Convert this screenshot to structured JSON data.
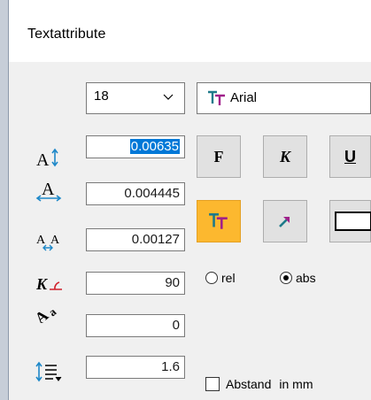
{
  "window": {
    "title": "Textattribute"
  },
  "size_combo": {
    "value": "18"
  },
  "font_combo": {
    "value": "Arial"
  },
  "fields": [
    {
      "icon": "text-height-icon",
      "value": "0.00635"
    },
    {
      "icon": "text-width-icon",
      "value": "0.004445"
    },
    {
      "icon": "char-spacing-icon",
      "value": "0.00127"
    },
    {
      "icon": "italic-angle-icon",
      "value": "90"
    },
    {
      "icon": "text-rotation-icon",
      "value": "0"
    },
    {
      "icon": "line-spacing-icon",
      "value": "1.6"
    }
  ],
  "style_buttons": {
    "bold": "F",
    "italic": "K",
    "underline": "U"
  },
  "radio": {
    "rel_label": "rel",
    "abs_label": "abs",
    "selected": "abs"
  },
  "checkbox": {
    "label": "Abstand",
    "unit": "in mm",
    "checked": false
  },
  "colors": {
    "accent_active": "#fcb82f",
    "selection": "#0078d7",
    "teal": "#1e7a8a",
    "magenta": "#a0208a"
  }
}
